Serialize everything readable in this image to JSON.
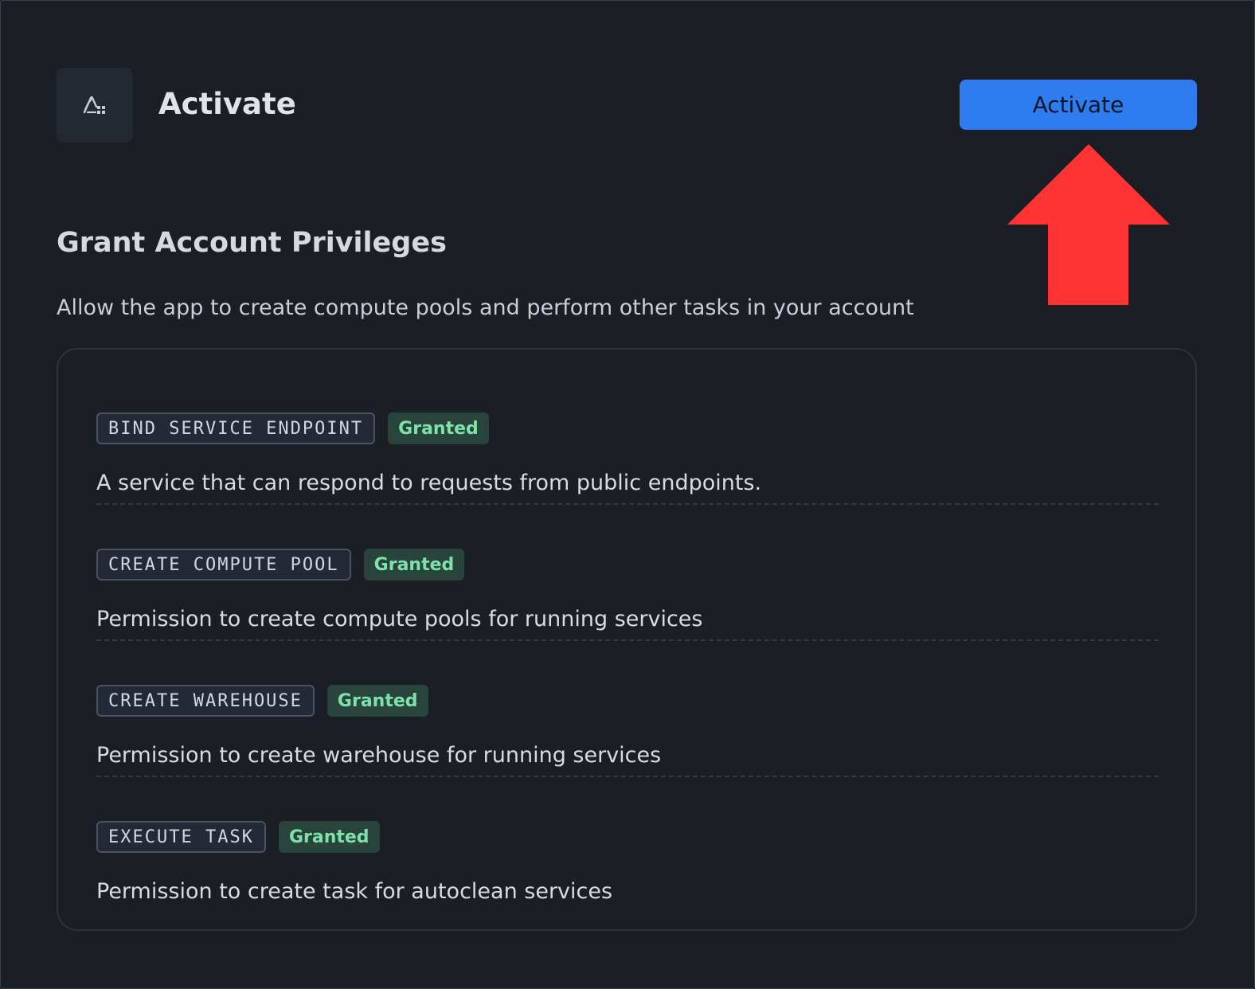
{
  "header": {
    "app_icon": "snowflake-app-icon",
    "title": "Activate",
    "activate_button_label": "Activate"
  },
  "annotation": {
    "arrow_color": "#ff3333",
    "arrow_icon": "arrow-up-icon"
  },
  "section": {
    "title": "Grant Account Privileges",
    "description": "Allow the app to create compute pools and perform other tasks in your account"
  },
  "privileges": [
    {
      "name": "BIND SERVICE ENDPOINT",
      "status": "Granted",
      "description": "A service that can respond to requests from public endpoints."
    },
    {
      "name": "CREATE COMPUTE POOL",
      "status": "Granted",
      "description": "Permission to create compute pools for running services"
    },
    {
      "name": "CREATE WAREHOUSE",
      "status": "Granted",
      "description": "Permission to create warehouse for running services"
    },
    {
      "name": "EXECUTE TASK",
      "status": "Granted",
      "description": "Permission to create task for autoclean services"
    }
  ],
  "colors": {
    "background": "#1b1f25",
    "accent": "#2f7bf0",
    "granted_text": "#7fe2a8",
    "granted_bg": "#29433d"
  }
}
